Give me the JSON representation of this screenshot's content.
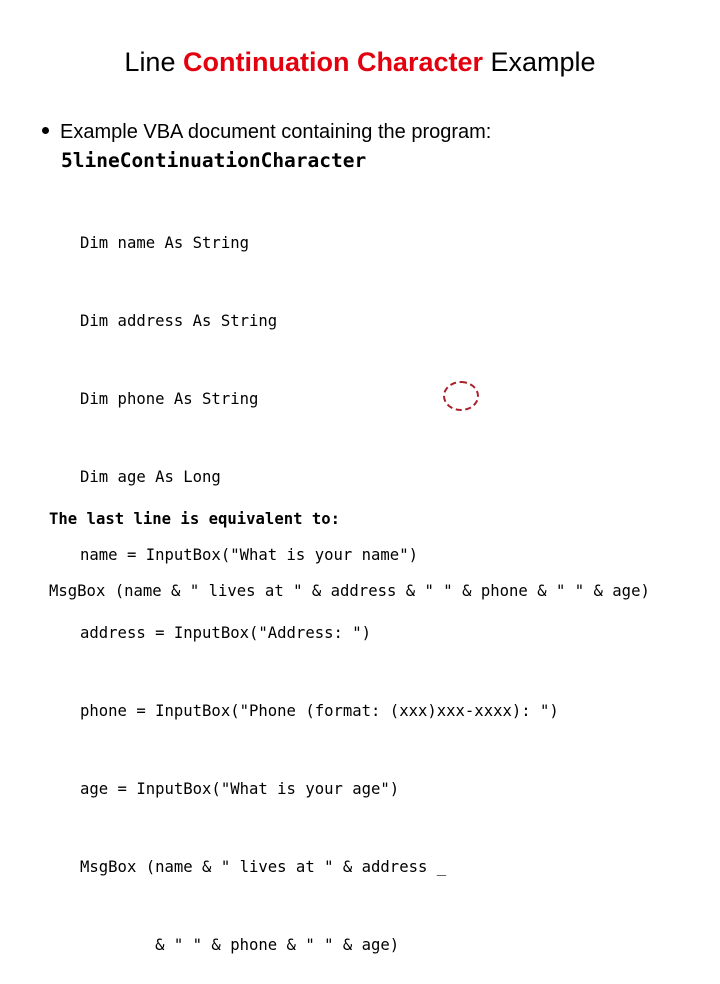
{
  "slide": {
    "title": {
      "prefix": "Line ",
      "highlight": "Continuation Character",
      "suffix": " Example",
      "highlight_color": "#e3000f"
    },
    "bullet": {
      "text": "Example VBA document containing the program:",
      "program_name": "5lineContinuationCharacter"
    },
    "code_lines": [
      "Dim name As String",
      "Dim address As String",
      "Dim phone As String",
      "Dim age As Long",
      "name = InputBox(\"What is your name\")",
      "address = InputBox(\"Address: \")",
      "phone = InputBox(\"Phone (format: (xxx)xxx-xxxx): \")",
      "age = InputBox(\"What is your age\")",
      "MsgBox (name & \" lives at \" & address _",
      "        & \" \" & phone & \" \" & age)"
    ],
    "annotation": {
      "target": "_",
      "style": "dashed-circle",
      "color": "#a8202a"
    },
    "note": {
      "heading": "The last line is equivalent to:",
      "code": "MsgBox (name & \" lives at \" & address & \" \" & phone & \" \" & age)"
    }
  }
}
